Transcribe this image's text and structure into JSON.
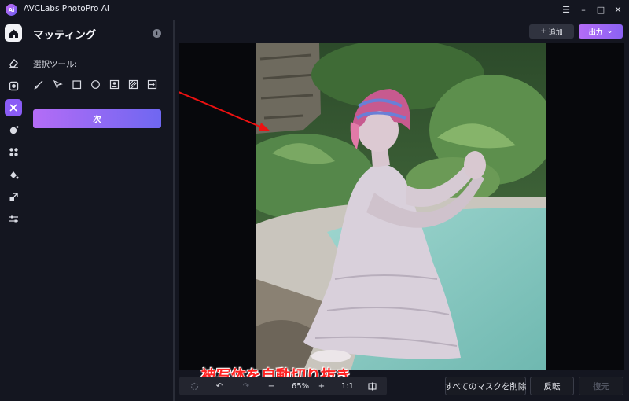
{
  "app": {
    "title": "AVCLabs PhotoPro AI",
    "logo_text": "Ai"
  },
  "window_controls": {
    "menu_icon": "☰",
    "minimize_icon": "–",
    "maximize_icon": "□",
    "close_icon": "✕"
  },
  "panel": {
    "title": "マッティング",
    "info_icon": "i",
    "tool_label": "選択ツール:",
    "next_label": "次"
  },
  "header": {
    "add_label": "追加",
    "add_icon": "+",
    "export_label": "出力",
    "export_icon": "⌄"
  },
  "toolbar": {
    "zoom": "65%",
    "ratio": "1:1",
    "undo_icon": "↶",
    "redo_icon": "↷",
    "zoom_out_icon": "−",
    "zoom_in_icon": "+"
  },
  "actions": {
    "clear_masks": "すべてのマスクを削除",
    "invert": "反転",
    "restore": "復元"
  },
  "annotation": {
    "caption": "被写体を自動切り抜き",
    "color": "#ff2222"
  },
  "colors": {
    "accent_start": "#b46cf6",
    "accent_end": "#6f67f1",
    "active_rail": "#8a5cf6",
    "background": "#141620"
  }
}
